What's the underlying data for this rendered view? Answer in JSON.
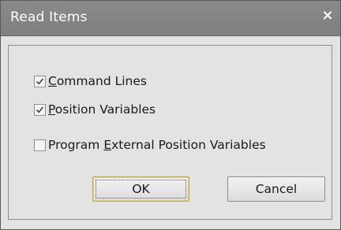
{
  "window": {
    "title": "Read Items",
    "close_glyph": "×"
  },
  "options": [
    {
      "mnemonic": "C",
      "rest": "ommand Lines",
      "checked": true
    },
    {
      "mnemonic": "P",
      "rest": "osition Variables",
      "checked": true
    },
    {
      "prefix": "Program ",
      "mnemonic": "E",
      "rest": "xternal Position Variables",
      "checked": false
    }
  ],
  "buttons": {
    "ok_label": "OK",
    "cancel_label": "Cancel"
  },
  "colors": {
    "titlebar": "#808080",
    "dialog_bg": "#e3e3e3",
    "ok_border": "#b8a25a"
  },
  "icons": {
    "close": "close-icon",
    "check": "checkmark-icon"
  }
}
